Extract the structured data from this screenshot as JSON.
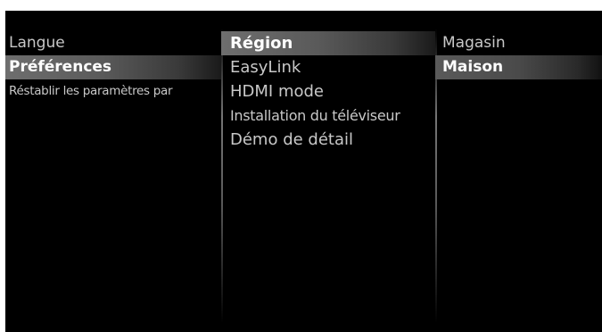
{
  "menu": {
    "level1": [
      {
        "label": "Langue",
        "state": "normal"
      },
      {
        "label": "Préférences",
        "state": "selected"
      },
      {
        "label": "Réstablir les paramètres par",
        "state": "normal"
      }
    ],
    "level2": [
      {
        "label": "Région",
        "state": "selected"
      },
      {
        "label": "EasyLink",
        "state": "normal"
      },
      {
        "label": "HDMI mode",
        "state": "normal"
      },
      {
        "label": "Installation du téléviseur",
        "state": "normal"
      },
      {
        "label": "Démo de détail",
        "state": "normal"
      }
    ],
    "level3": [
      {
        "label": "Magasin",
        "state": "normal"
      },
      {
        "label": "Maison",
        "state": "selected"
      }
    ]
  },
  "colors": {
    "background": "#000000",
    "text_normal": "#c8c8c8",
    "text_selected": "#ffffff",
    "highlight": "#6e6e6e"
  }
}
